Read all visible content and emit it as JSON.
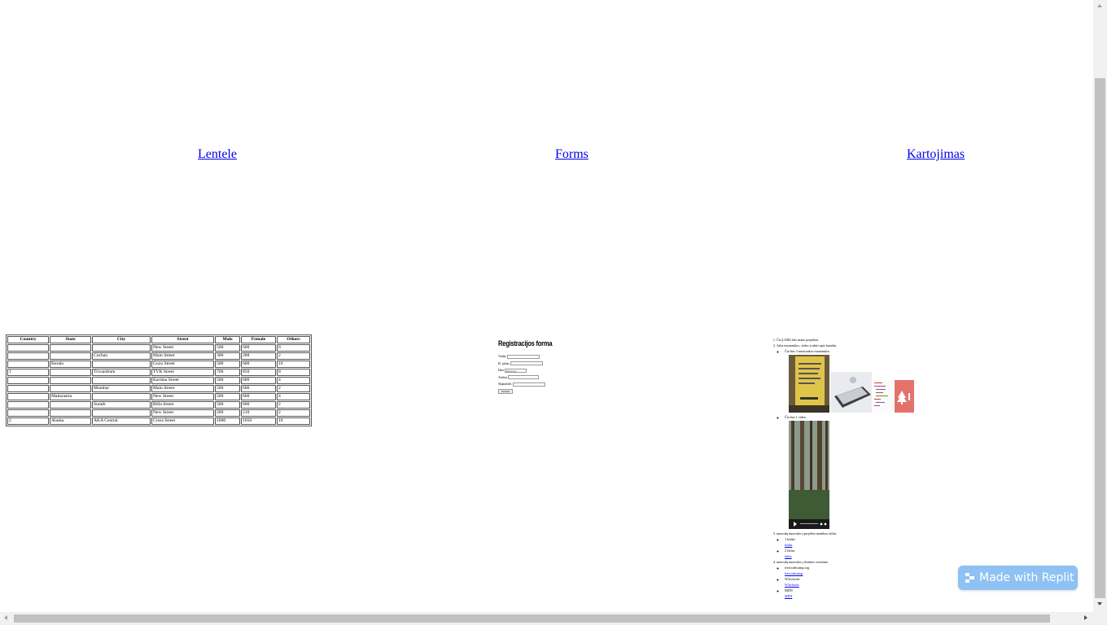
{
  "nav": {
    "links": [
      "Lentele",
      "Forms",
      "Kartojimas"
    ]
  },
  "table": {
    "headers": [
      "Country",
      "State",
      "City",
      "Street",
      "Male",
      "Female",
      "Others"
    ],
    "rows": [
      [
        "",
        "",
        "",
        "New Street",
        "500",
        "600",
        "6"
      ],
      [
        "",
        "",
        "Cochan",
        "Main Street",
        "300",
        "288",
        "2"
      ],
      [
        "",
        "Kerala",
        "",
        "Gozu Street",
        "500",
        "600",
        "10"
      ],
      [
        "1",
        "",
        "Trivandrum",
        "TVK Street",
        "700",
        "850",
        "8"
      ],
      [
        "",
        "",
        "",
        "Karisha Street",
        "500",
        "600",
        "4"
      ],
      [
        "",
        "",
        "Mumbai",
        "Main Street",
        "500",
        "600",
        "2"
      ],
      [
        "",
        "Maharastra",
        "",
        "New Street",
        "500",
        "600",
        "4"
      ],
      [
        "",
        "",
        "Surath",
        "Billa Street",
        "500",
        "600",
        "2"
      ],
      [
        "",
        "",
        "",
        "New Street",
        "200",
        "210",
        "2"
      ],
      [
        "2",
        "Alaska",
        "AKA Central",
        "Cross Street",
        "1000",
        "1050",
        "10"
      ]
    ]
  },
  "form": {
    "title": "Registracijos forma",
    "fields": [
      {
        "label": "Vardas",
        "value": ""
      },
      {
        "label": "El. paštas",
        "value": ""
      },
      {
        "label": "Data",
        "value": "mm-dd-yy"
      },
      {
        "label": "Amžius",
        "value": ""
      },
      {
        "label": "Slaptažodis",
        "value": ""
      }
    ],
    "submit_label": "Išsiųsti"
  },
  "list": {
    "item1": "Čia Į ORG būs mano projektai",
    "item2": "Arba nuotraukos, video ir nkitt apie kanalas",
    "item2_sub1": "Čia bus 3 nuotraukos nuotraukos",
    "item2_sub2": "Čia bus 1 video",
    "item3": "nuorodų nuorodos į projekto manikos failus",
    "item3_sub1": "1 kodas",
    "item3_sub1_link": "kodas",
    "item3_sub2": "2 failas",
    "item3_sub2_link": "failas",
    "item4": "nuorodų nuorodos į išorines svetaines",
    "item4_sub1": "freecodecamp.org",
    "item4_sub1_link": "freecodecamp",
    "item4_sub2": "W3schools",
    "item4_sub2_link": "W3schools",
    "item4_sub3": "MDN",
    "item4_sub3_link": "MDN"
  },
  "badge": {
    "label": "Made with Replit"
  },
  "colors": {
    "link": "#0000ee",
    "badge_bg": "#8ec1f4",
    "scrollbar_track": "#f1f1f1",
    "scrollbar_thumb": "#c1c1c1"
  }
}
